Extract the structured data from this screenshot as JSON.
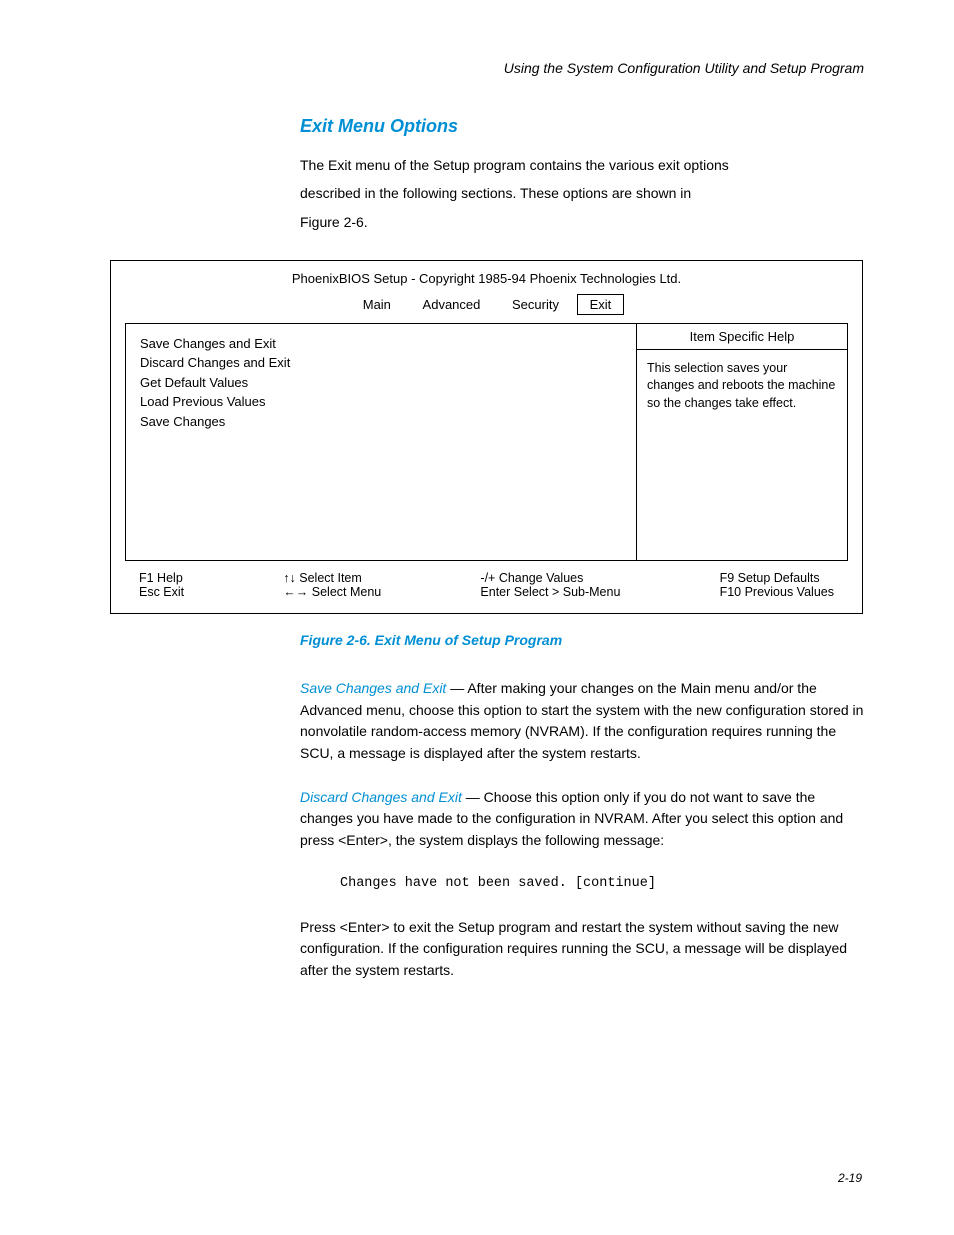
{
  "header": {
    "chapter": "Using the System Configuration Utility and Setup Program"
  },
  "section": {
    "heading": "Exit Menu Options",
    "intro_line1": "The Exit menu of the Setup program contains the various exit options",
    "intro_line2": "described in the following sections. These options are shown in",
    "intro_line3": "Figure 2-6."
  },
  "bios": {
    "title": "PhoenixBIOS Setup - Copyright 1985-94 Phoenix Technologies Ltd.",
    "tabs": {
      "main": "Main",
      "advanced": "Advanced",
      "security": "Security",
      "exit": "Exit"
    },
    "left": {
      "line1": "Save Changes and Exit",
      "line2": "Discard Changes and Exit",
      "line3": "Get Default Values",
      "line4": "Load Previous Values",
      "line5": "Save Changes"
    },
    "right": {
      "header": "Item Specific Help",
      "body": "This selection saves your changes and reboots the machine so the changes take effect."
    },
    "footer": {
      "c1a": "F1   Help",
      "c1b": "Esc  Exit",
      "c2a": "↑↓  Select Item",
      "c2b": "←→  Select Menu",
      "c3a": "-/+      Change Values",
      "c3b": "Enter   Select > Sub-Menu",
      "c4a": "F9   Setup Defaults",
      "c4b": "F10 Previous Values"
    }
  },
  "caption": "Figure 2-6.  Exit Menu of Setup Program",
  "options": {
    "save": {
      "title": "Save Changes and Exit",
      "body": " — After making your changes on the Main menu and/or the Advanced menu, choose this option to start the system with the new configuration stored in nonvolatile random-access memory (NVRAM). If the configuration requires running the SCU, a message is displayed after the system restarts."
    },
    "discard": {
      "title": "Discard Changes and Exit",
      "body": " — Choose this option only if you do not want to save the changes you have made to the configuration in NVRAM. After you select this option and press <Enter>, the system displays the following message:"
    },
    "prompt": "Changes have not been saved. [continue]",
    "after_prompt": "Press <Enter> to exit the Setup program and restart the system without saving the new configuration. If the configuration requires running the SCU, a message will be displayed after the system restarts."
  },
  "page_number": "2-19"
}
